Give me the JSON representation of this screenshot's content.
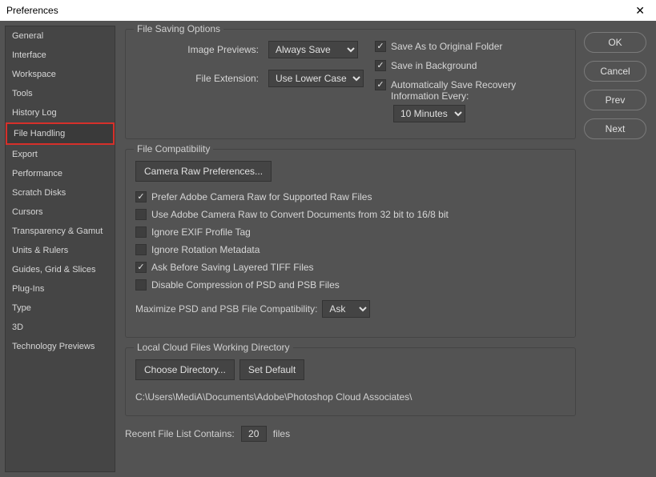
{
  "window": {
    "title": "Preferences"
  },
  "sidebar": {
    "items": [
      {
        "label": "General"
      },
      {
        "label": "Interface"
      },
      {
        "label": "Workspace"
      },
      {
        "label": "Tools"
      },
      {
        "label": "History Log"
      },
      {
        "label": "File Handling"
      },
      {
        "label": "Export"
      },
      {
        "label": "Performance"
      },
      {
        "label": "Scratch Disks"
      },
      {
        "label": "Cursors"
      },
      {
        "label": "Transparency & Gamut"
      },
      {
        "label": "Units & Rulers"
      },
      {
        "label": "Guides, Grid & Slices"
      },
      {
        "label": "Plug-Ins"
      },
      {
        "label": "Type"
      },
      {
        "label": "3D"
      },
      {
        "label": "Technology Previews"
      }
    ],
    "activeIndex": 5
  },
  "buttons": {
    "ok": "OK",
    "cancel": "Cancel",
    "prev": "Prev",
    "next": "Next"
  },
  "fileSaving": {
    "title": "File Saving Options",
    "imagePreviewsLabel": "Image Previews:",
    "imagePreviewsValue": "Always Save",
    "fileExtLabel": "File Extension:",
    "fileExtValue": "Use Lower Case",
    "saveAsOriginal": "Save As to Original Folder",
    "saveBackground": "Save in Background",
    "autoSaveRecovery1": "Automatically Save Recovery",
    "autoSaveRecovery2": "Information Every:",
    "autoSaveInterval": "10 Minutes"
  },
  "fileCompat": {
    "title": "File Compatibility",
    "cameraRawBtn": "Camera Raw Preferences...",
    "preferACR": "Prefer Adobe Camera Raw for Supported Raw Files",
    "useACR32": "Use Adobe Camera Raw to Convert Documents from 32 bit to 16/8 bit",
    "ignoreExif": "Ignore EXIF Profile Tag",
    "ignoreRotation": "Ignore Rotation Metadata",
    "askTiff": "Ask Before Saving Layered TIFF Files",
    "disableCompression": "Disable Compression of PSD and PSB Files",
    "maxPsdLabel": "Maximize PSD and PSB File Compatibility:",
    "maxPsdValue": "Ask"
  },
  "cloud": {
    "title": "Local Cloud Files Working Directory",
    "chooseBtn": "Choose Directory...",
    "defaultBtn": "Set Default",
    "path": "C:\\Users\\MediA\\Documents\\Adobe\\Photoshop Cloud Associates\\"
  },
  "recent": {
    "label": "Recent File List Contains:",
    "value": "20",
    "suffix": "files"
  }
}
